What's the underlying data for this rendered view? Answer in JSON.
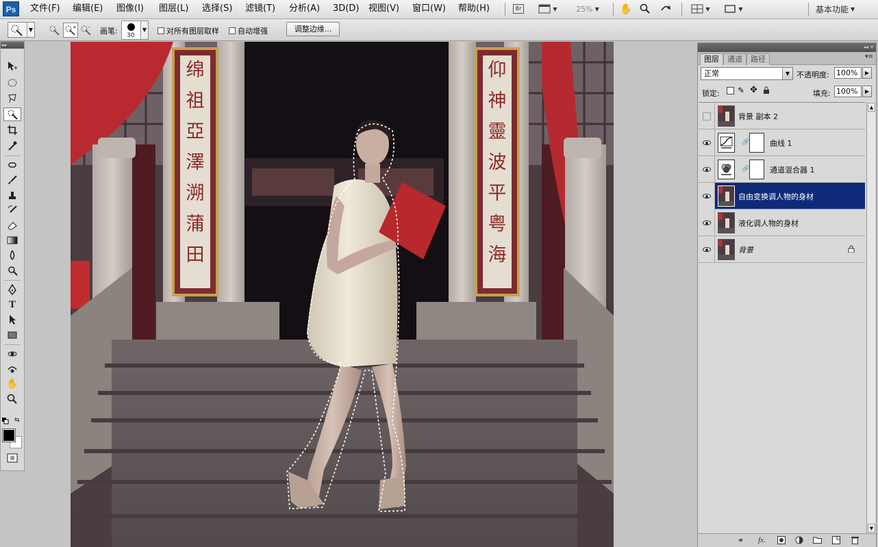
{
  "app": {
    "logo": "Ps"
  },
  "menu": [
    "文件(F)",
    "编辑(E)",
    "图像(I)",
    "图层(L)",
    "选择(S)",
    "滤镜(T)",
    "分析(A)",
    "3D(D)",
    "视图(V)",
    "窗口(W)",
    "帮助(H)"
  ],
  "menubar": {
    "bridge_label": "Br",
    "zoom": "25%",
    "workspace": "基本功能"
  },
  "options": {
    "brush_label": "画笔:",
    "brush_size": "30",
    "sample_all": "对所有图层取样",
    "auto_enhance": "自动增强",
    "refine_edge": "调整边缘..."
  },
  "layers_panel": {
    "tabs": [
      "图层",
      "通道",
      "路径"
    ],
    "blend_mode": "正常",
    "opacity_label": "不透明度:",
    "opacity": "100%",
    "lock_label": "锁定:",
    "fill_label": "填充:",
    "fill": "100%",
    "layers": [
      {
        "name": "背景 副本 2",
        "visible": false,
        "type": "image",
        "selected": false
      },
      {
        "name": "曲线 1",
        "visible": true,
        "type": "curves",
        "selected": false
      },
      {
        "name": "通道混合器 1",
        "visible": true,
        "type": "channel-mixer",
        "selected": false
      },
      {
        "name": "自由变换调人物的身材",
        "visible": true,
        "type": "image",
        "selected": true
      },
      {
        "name": "液化调人物的身材",
        "visible": true,
        "type": "image",
        "selected": false
      },
      {
        "name": "背景",
        "visible": true,
        "type": "image",
        "selected": false,
        "locked": true
      }
    ]
  },
  "canvas": {
    "plaque_left": [
      "绵",
      "祖",
      "亞",
      "澤",
      "溯",
      "蒲",
      "田"
    ],
    "plaque_right": [
      "仰",
      "神",
      "靈",
      "波",
      "平",
      "粤",
      "海"
    ]
  },
  "colors": {
    "accent_selected": "#0f2a78",
    "banner_red": "#b92a30",
    "dress": "#e8e1cf"
  }
}
